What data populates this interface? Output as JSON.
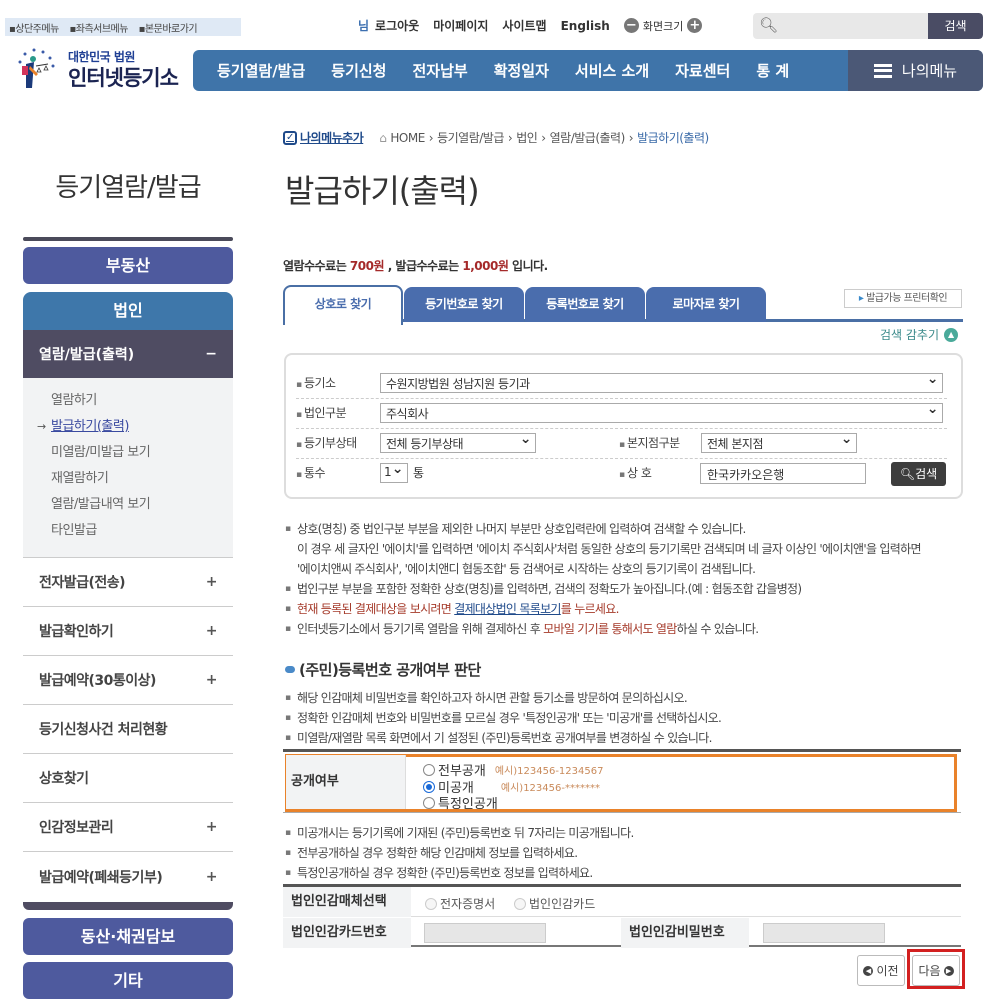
{
  "skip_links": [
    "상단주메뉴",
    "좌측서브메뉴",
    "본문바로가기"
  ],
  "util": {
    "nim": "님",
    "logout": "로그아웃",
    "mypage": "마이페이지",
    "sitemap": "사이트맵",
    "english": "English",
    "screen_size": "화면크기",
    "search_button": "검색",
    "search_value": ""
  },
  "logo": {
    "line1": "대한민국 법원",
    "line2": "인터넷등기소"
  },
  "gnb": {
    "items": [
      "등기열람/발급",
      "등기신청",
      "전자납부",
      "확정일자",
      "서비스 소개",
      "자료센터",
      "통 계"
    ],
    "my_menu": "나의메뉴"
  },
  "lnb": {
    "title": "등기열람/발급",
    "real_estate": "부동산",
    "corporation": "법인",
    "active_group": "열람/발급(출력)",
    "active_toggle": "−",
    "sub_items": [
      "열람하기",
      "발급하기(출력)",
      "미열람/미발급 보기",
      "재열람하기",
      "열람/발급내역 보기",
      "타인발급"
    ],
    "current_sub": "발급하기(출력)",
    "groups": [
      {
        "label": "전자발급(전송)",
        "toggle": "+"
      },
      {
        "label": "발급확인하기",
        "toggle": "+"
      },
      {
        "label": "발급예약(30통이상)",
        "toggle": "+"
      },
      {
        "label": "등기신청사건 처리현황",
        "toggle": ""
      },
      {
        "label": "상호찾기",
        "toggle": ""
      },
      {
        "label": "인감정보관리",
        "toggle": "+"
      },
      {
        "label": "발급예약(폐쇄등기부)",
        "toggle": "+"
      }
    ],
    "movable": "동산·채권담보",
    "etc": "기타"
  },
  "breadcrumb": {
    "add_menu": "나의메뉴추가",
    "items": [
      "HOME",
      "등기열람/발급",
      "법인",
      "열람/발급(출력)",
      "발급하기(출력)"
    ]
  },
  "page_title": "발급하기(출력)",
  "fee": {
    "pre": "열람수수료는 ",
    "view_fee": "700원",
    "mid": " , 발급수수료는 ",
    "issue_fee": "1,000원",
    "post": " 입니다."
  },
  "tabs": [
    "상호로 찾기",
    "등기번호로 찾기",
    "등록번호로 찾기",
    "로마자로 찾기"
  ],
  "active_tab": "상호로 찾기",
  "printer_check": "발급가능 프린터확인",
  "hide_search": "검색 감추기",
  "search_form": {
    "registry_label": "등기소",
    "registry_value": "수원지방법원 성남지원 등기과",
    "corp_type_label": "법인구분",
    "corp_type_value": "주식회사",
    "status_label": "등기부상태",
    "status_value": "전체 등기부상태",
    "branch_label": "본지점구분",
    "branch_value": "전체 본지점",
    "copies_label": "통수",
    "copies_value": "1",
    "copies_unit": "통",
    "name_label": "상 호",
    "name_value": "한국카카오은행",
    "search_button": "검색"
  },
  "notes1": {
    "n1": "상호(명칭) 중 법인구분 부분을 제외한 나머지 부분만 상호입력란에 입력하여 검색할 수 있습니다.",
    "n1b": "이 경우 세 글자인 '에이치'를 입력하면 '에이치 주식회사'처럼 동일한 상호의 등기기록만 검색되며 네 글자 이상인 '에이치앤'을 입력하면",
    "n1c": "'에이치앤씨 주식회사', '에이치앤디 협동조합' 등 검색어로 시작하는 상호의 등기기록이 검색됩니다.",
    "n2": "법인구분 부분을 포함한 정확한 상호(명칭)를 입력하면, 검색의 정확도가 높아집니다.(예 : 협동조합 갑을병정)",
    "n3_pre": "현재 등록된 결제대상을 보시려면 ",
    "n3_link": "결제대상법인 목록보기",
    "n3_post": "를 누르세요.",
    "n4_pre": "인터넷등기소에서 등기기록 열람을 위해 결제하신 후 ",
    "n4_red": "모바일 기기를 통해서도 열람",
    "n4_post": "하실 수 있습니다."
  },
  "section_title": "(주민)등록번호 공개여부 판단",
  "notes2": [
    "해당 인감매체 비밀번호를 확인하고자 하시면 관할 등기소를 방문하여 문의하십시오.",
    "정확한 인감매체 번호와 비밀번호를 모르실 경우 '특정인공개' 또는 '미공개'를 선택하십시오.",
    "미열람/재열람 목록 화면에서 기 설정된 (주민)등록번호 공개여부를 변경하실 수 있습니다."
  ],
  "disclosure": {
    "label": "공개여부",
    "options": [
      {
        "label": "전부공개",
        "example": "예시)123456-1234567",
        "selected": false
      },
      {
        "label": "미공개",
        "example": "예시)123456-*******",
        "selected": true
      },
      {
        "label": "특정인공개",
        "example": "",
        "selected": false
      }
    ]
  },
  "notes3": [
    "미공개시는 등기기록에 기재된 (주민)등록번호 뒤 7자리는 미공개됩니다.",
    "전부공개하실 경우 정확한 해당 인감매체 정보를 입력하세요.",
    "특정인공개하실 경우 정확한 (주민)등록번호 정보를 입력하세요."
  ],
  "seal": {
    "media_label": "법인인감매체선택",
    "media_options": [
      "전자증명서",
      "법인인감카드"
    ],
    "card_no_label": "법인인감카드번호",
    "card_no_value": "",
    "password_label": "법인인감비밀번호",
    "password_value": ""
  },
  "buttons": {
    "prev": "이전",
    "next": "다음"
  }
}
